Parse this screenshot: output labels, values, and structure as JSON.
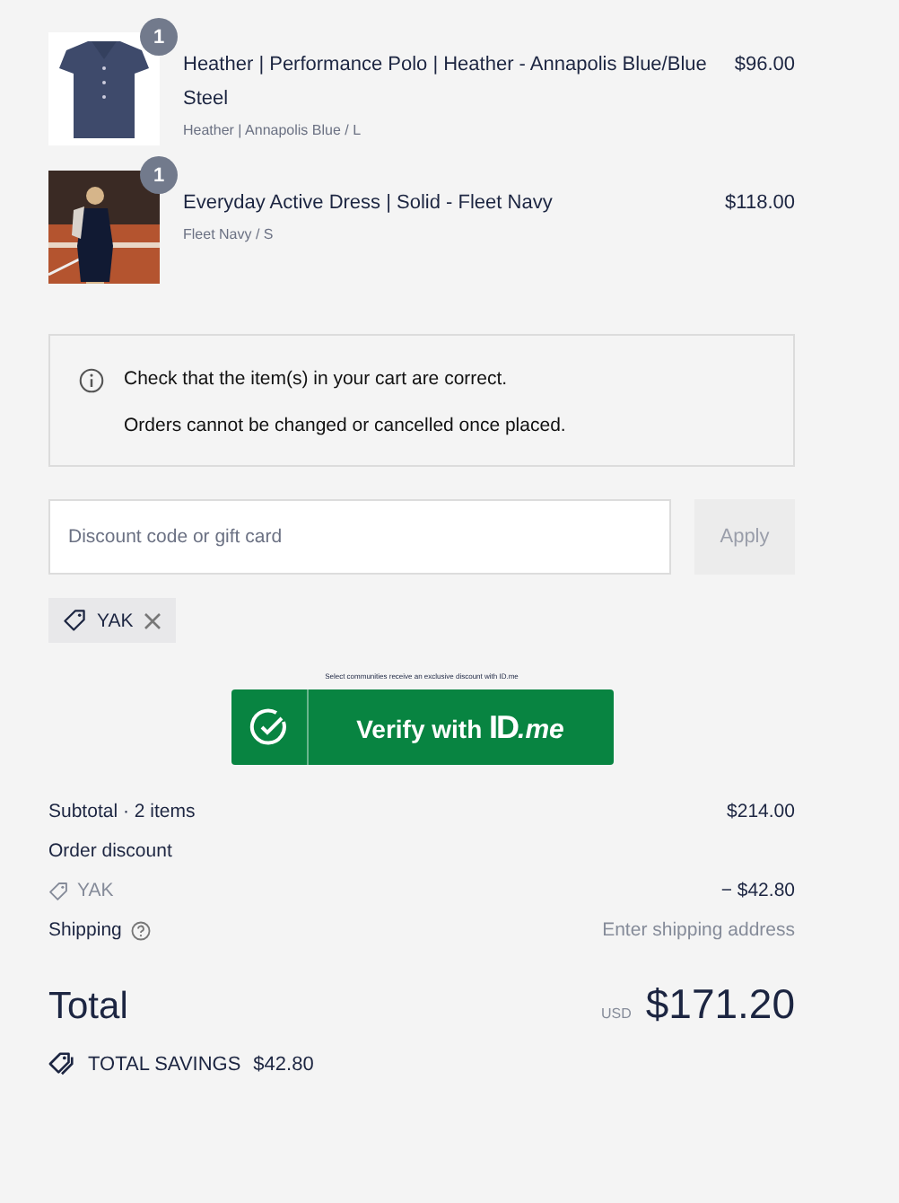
{
  "items": [
    {
      "name": "Heather | Performance Polo | Heather - Annapolis Blue/Blue Steel",
      "variant": "Heather | Annapolis Blue / L",
      "price": "$96.00",
      "quantity": "1"
    },
    {
      "name": "Everyday Active Dress | Solid - Fleet Navy",
      "variant": "Fleet Navy / S",
      "price": "$118.00",
      "quantity": "1"
    }
  ],
  "notice": {
    "lines": [
      "Check that the item(s) in your cart are correct.",
      "Orders cannot be changed or cancelled once placed."
    ]
  },
  "discount": {
    "placeholder": "Discount code or gift card",
    "apply_label": "Apply",
    "disabled": true
  },
  "applied_codes": [
    {
      "code": "YAK"
    }
  ],
  "idme": {
    "caption": "Select communities receive an exclusive discount with ID.me",
    "label": "Verify with",
    "logo_main": "ID",
    "logo_suffix": ".me"
  },
  "summary": {
    "subtotal_label": "Subtotal · 2 items",
    "subtotal": "$214.00",
    "discount_label": "Order discount",
    "discount_code": "YAK",
    "discount_amount": "− $42.80",
    "shipping_label": "Shipping",
    "shipping_value": "Enter shipping address"
  },
  "total": {
    "label": "Total",
    "currency": "USD",
    "amount": "$171.20"
  },
  "savings": {
    "label": "TOTAL SAVINGS",
    "amount": "$42.80"
  }
}
